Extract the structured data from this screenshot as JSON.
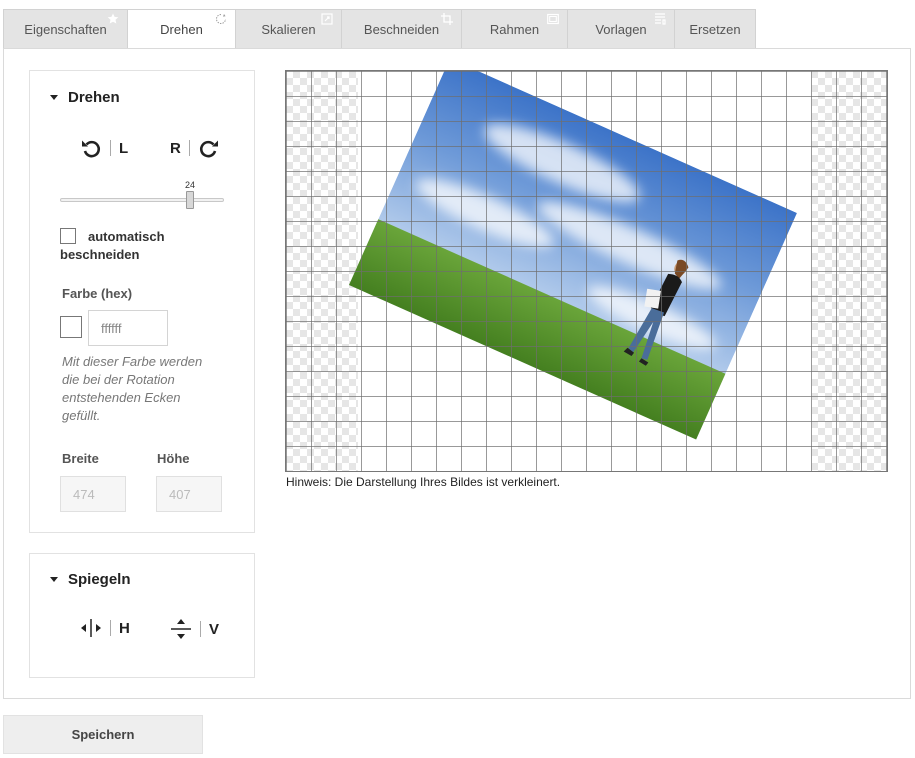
{
  "tabs": [
    {
      "label": "Eigenschaften",
      "icon": "star-icon"
    },
    {
      "label": "Drehen",
      "icon": "rotate-icon"
    },
    {
      "label": "Skalieren",
      "icon": "resize-icon"
    },
    {
      "label": "Beschneiden",
      "icon": "crop-icon"
    },
    {
      "label": "Rahmen",
      "icon": "frame-icon"
    },
    {
      "label": "Vorlagen",
      "icon": "template-icon"
    },
    {
      "label": "Ersetzen",
      "icon": ""
    }
  ],
  "rotate": {
    "title": "Drehen",
    "left_label": "L",
    "right_label": "R",
    "slider_value": "24",
    "auto_crop_label": "automatisch beschneiden",
    "color_label": "Farbe (hex)",
    "color_value": "ffffff",
    "color_hint": "Mit dieser Farbe werden die bei der Rotation entstehenden Ecken gefüllt.",
    "width_label": "Breite",
    "width_value": "474",
    "height_label": "Höhe",
    "height_value": "407"
  },
  "mirror": {
    "title": "Spiegeln",
    "h_label": "H",
    "v_label": "V"
  },
  "canvas": {
    "note": "Hinweis: Die Darstellung Ihres Bildes ist verkleinert."
  },
  "save_label": "Speichern"
}
